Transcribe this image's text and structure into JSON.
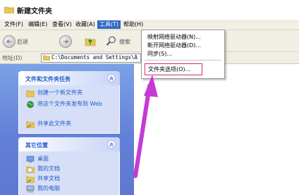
{
  "window": {
    "title": "新建文件夹"
  },
  "menubar": {
    "items": [
      "文件(F)",
      "编辑(E)",
      "查看(V)",
      "收藏(A)",
      "工具(T)",
      "帮助(H)"
    ]
  },
  "toolbar": {
    "back_label": "后退",
    "search_label": "搜索"
  },
  "address": {
    "label": "地址(D)",
    "value": "C:\\Documents and Settings\\A"
  },
  "tools_menu": {
    "items": [
      "映射网络驱动器(N)...",
      "断开网络驱动器(D)...",
      "同步(S)..."
    ],
    "folder_options": "文件夹选项(O)..."
  },
  "left_pane": {
    "file_tasks": {
      "title": "文件和文件夹任务",
      "tasks": [
        "创建一个新文件夹",
        "将这个文件夹发布到 Web",
        "共享此文件夹"
      ]
    },
    "other_places": {
      "title": "其它位置",
      "places": [
        "桌面",
        "我的文档",
        "共享文档",
        "我的电脑"
      ]
    }
  },
  "colors": {
    "menu_highlight": "#3168c8",
    "pane_blue": "#6a8ce0",
    "link_blue": "#215dc6",
    "annotation_magenta": "#c53ad6"
  }
}
